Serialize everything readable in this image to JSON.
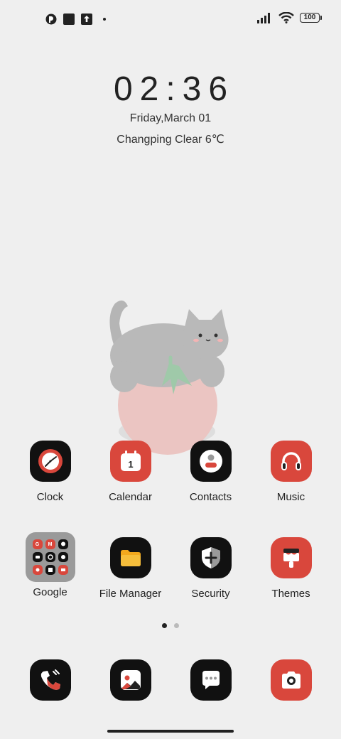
{
  "status_bar": {
    "battery": "100",
    "icons": [
      "app-notification-icon",
      "square-notification-icon",
      "upload-icon",
      "more-dot",
      "signal-icon",
      "wifi-icon",
      "battery-icon"
    ]
  },
  "lockscreen": {
    "time": "02:36",
    "date": "Friday,March 01",
    "weather": "Changping Clear 6℃"
  },
  "apps_row1": [
    {
      "label": "Clock",
      "icon": "clock-icon"
    },
    {
      "label": "Calendar",
      "icon": "calendar-icon",
      "badge": "1"
    },
    {
      "label": "Contacts",
      "icon": "contacts-icon"
    },
    {
      "label": "Music",
      "icon": "headphones-icon"
    }
  ],
  "apps_row2": [
    {
      "label": "Google",
      "icon": "folder-icon"
    },
    {
      "label": "File Manager",
      "icon": "file-folder-icon"
    },
    {
      "label": "Security",
      "icon": "shield-icon"
    },
    {
      "label": "Themes",
      "icon": "paint-brush-icon"
    }
  ],
  "google_folder": [
    "G",
    "M",
    "",
    "",
    "",
    "",
    "",
    "",
    ""
  ],
  "dock": [
    {
      "icon": "phone-icon"
    },
    {
      "icon": "gallery-icon"
    },
    {
      "icon": "messages-icon"
    },
    {
      "icon": "camera-icon"
    }
  ],
  "colors": {
    "background": "#efefef",
    "accent_red": "#d9473c",
    "icon_black": "#111111"
  },
  "page_indicator": {
    "pages": 2,
    "current": 1
  }
}
